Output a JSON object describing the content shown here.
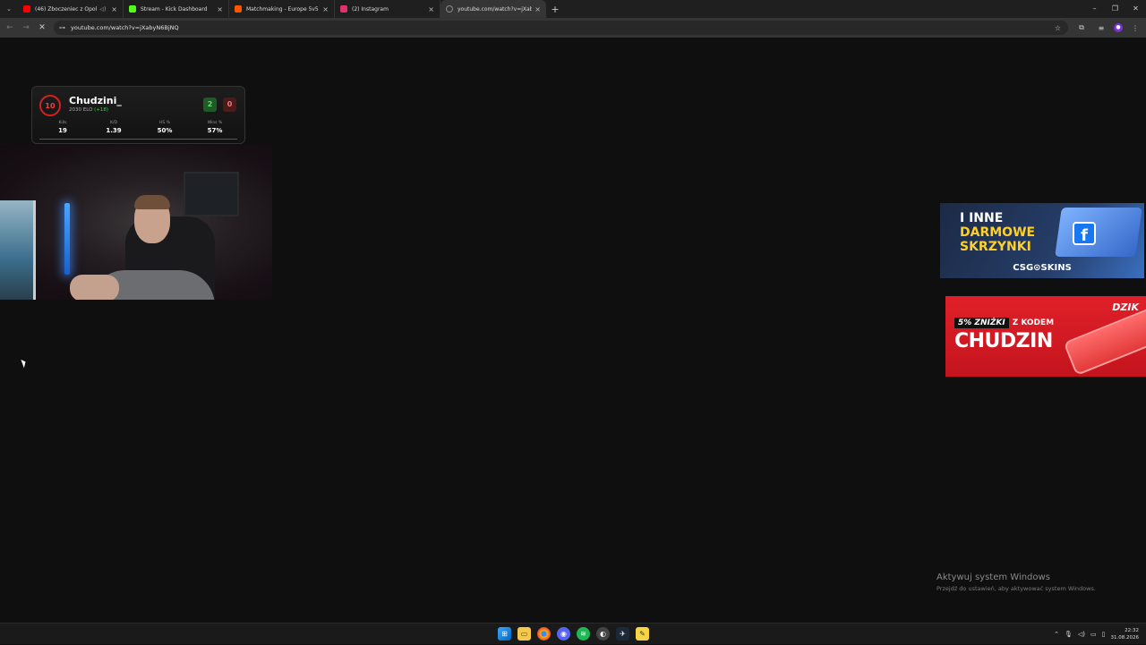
{
  "browser": {
    "tabs": [
      {
        "title": "(46) Zboczeniec z Opola - Yo",
        "favicon_color": "#ff0000",
        "muted": true,
        "active": false
      },
      {
        "title": "Stream - Kick Dashboard",
        "favicon_color": "#53fc18",
        "muted": false,
        "active": false
      },
      {
        "title": "Matchmaking - Europe 5v5 Qu",
        "favicon_color": "#ff5500",
        "muted": false,
        "active": false
      },
      {
        "title": "(2) Instagram",
        "favicon_color": "#e1306c",
        "muted": false,
        "active": false
      },
      {
        "title": "youtube.com/watch?v=jXabyN",
        "favicon_color": "#888888",
        "muted": false,
        "active": true
      }
    ],
    "new_tab_icon": "plus-icon",
    "url": "youtube.com/watch?v=jXabyN6BjNQ"
  },
  "overlay": {
    "level": "10",
    "player_name": "Chudzini_",
    "elo_text": "2030 ELO",
    "elo_gain": "(+18)",
    "wins": "2",
    "losses": "0",
    "stats": [
      {
        "label": "Kills",
        "value": "19"
      },
      {
        "label": "K/D",
        "value": "1.39"
      },
      {
        "label": "HS %",
        "value": "50%"
      },
      {
        "label": "Wins %",
        "value": "57%"
      }
    ]
  },
  "ads": {
    "csgoskins": {
      "line1": "I INNE",
      "line2": "DARMOWE",
      "line3": "SKRZYNKI",
      "brand": "CSG⊙SKINS",
      "fb_letter": "f"
    },
    "dzik": {
      "percent": "5% ZNIŻKI",
      "promo": "Z KODEM",
      "code": "CHUDZIN",
      "brand": "DZIK"
    }
  },
  "watermark": {
    "title": "Aktywuj system Windows",
    "subtitle": "Przejdź do ustawień, aby aktywować system Windows."
  },
  "taskbar": {
    "time": "22:32",
    "date": "31.08.2026"
  },
  "colors": {
    "accent_red": "#d42020",
    "win_green": "#5fe06c",
    "loss_red": "#ff7575"
  }
}
